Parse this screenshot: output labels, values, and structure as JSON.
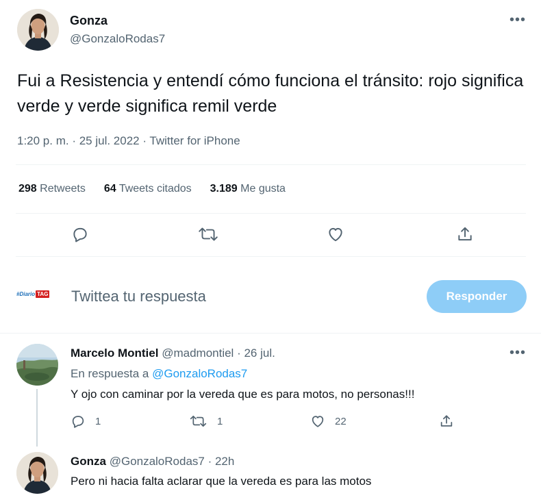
{
  "tweet": {
    "author_name": "Gonza",
    "author_handle": "@GonzaloRodas7",
    "text": "Fui a Resistencia y entendí cómo funciona el tránsito: rojo significa verde y verde significa remil verde",
    "meta": "1:20 p. m. · 25 jul. 2022 · Twitter for iPhone",
    "stats": [
      {
        "count": "298",
        "label": "Retweets"
      },
      {
        "count": "64",
        "label": "Tweets citados"
      },
      {
        "count": "3.189",
        "label": "Me gusta"
      }
    ],
    "actions": [
      "reply-icon",
      "retweet-icon",
      "like-icon",
      "share-icon"
    ]
  },
  "composer": {
    "logo_part1": "#Diario",
    "logo_part2": "TAG",
    "placeholder": "Twittea tu respuesta",
    "button_label": "Responder",
    "button_color": "#8ecdf7"
  },
  "replies": [
    {
      "author_name": "Marcelo Montiel",
      "author_handle": "@madmontiel",
      "time": "· 26 jul.",
      "replying_prefix": "En respuesta a",
      "replying_handle": "@GonzaloRodas7",
      "text": "Y ojo con caminar por la vereda que es para motos, no personas!!!",
      "reply_count": "1",
      "retweet_count": "1",
      "like_count": "22"
    },
    {
      "author_name": "Gonza",
      "author_handle": "@GonzaloRodas7",
      "time": "· 22h",
      "text": "Pero ni hacia falta aclarar que la vereda es para las motos"
    }
  ],
  "colors": {
    "accent": "#1d9bf0",
    "secondary_text": "#536471",
    "divider": "#eff3f4"
  }
}
